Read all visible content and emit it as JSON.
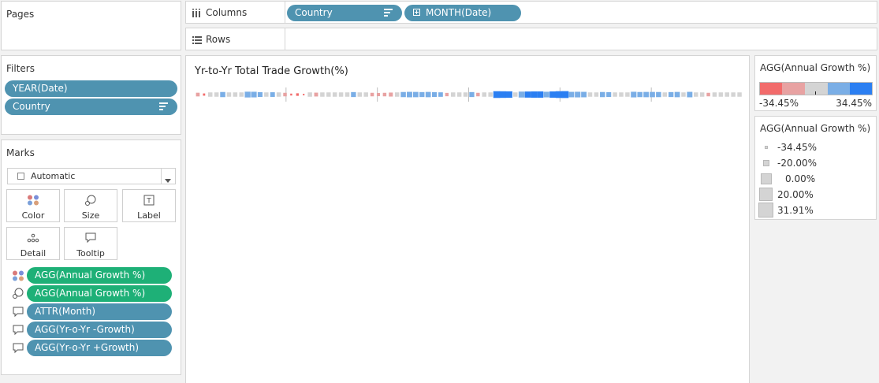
{
  "pages": {
    "title": "Pages"
  },
  "columns_shelf": {
    "label": "Columns",
    "icon": "columns-icon",
    "pills": [
      {
        "label": "Country"
      },
      {
        "label": "MONTH(Date)"
      }
    ]
  },
  "rows_shelf": {
    "label": "Rows",
    "icon": "rows-icon"
  },
  "filters": {
    "title": "Filters",
    "pills": [
      {
        "label": "YEAR(Date)"
      },
      {
        "label": "Country"
      }
    ]
  },
  "marks": {
    "title": "Marks",
    "mark_type": "Automatic",
    "buttons": [
      {
        "label": "Color",
        "icon": "color-icon"
      },
      {
        "label": "Size",
        "icon": "size-icon"
      },
      {
        "label": "Label",
        "icon": "label-icon"
      },
      {
        "label": "Detail",
        "icon": "detail-icon"
      },
      {
        "label": "Tooltip",
        "icon": "tooltip-icon"
      }
    ],
    "fields": [
      {
        "label": "AGG(Annual Growth %)",
        "icon": "color-icon",
        "color": "#1eb077"
      },
      {
        "label": "AGG(Annual Growth %)",
        "icon": "size-icon",
        "color": "#1eb077"
      },
      {
        "label": "ATTR(Month)",
        "icon": "tooltip-icon",
        "color": "#4f93b0"
      },
      {
        "label": "AGG(Yr-o-Yr -Growth)",
        "icon": "tooltip-icon",
        "color": "#4f93b0"
      },
      {
        "label": "AGG(Yr-o-Yr +Growth)",
        "icon": "tooltip-icon",
        "color": "#4f93b0"
      }
    ]
  },
  "view": {
    "title": "Yr-to-Yr Total Trade Growth(%)"
  },
  "color_legend": {
    "title": "AGG(Annual Growth %)",
    "min_label": "-34.45%",
    "max_label": "34.45%",
    "colors": [
      "#f26b6b",
      "#e8a2a2",
      "#d4d4d4",
      "#7aaee6",
      "#2b7ff2"
    ]
  },
  "size_legend": {
    "title": "AGG(Annual Growth %)",
    "items": [
      {
        "label": "-34.45%",
        "value": -34.45
      },
      {
        "label": "-20.00%",
        "value": -20.0
      },
      {
        "label": "0.00%",
        "value": 0.0
      },
      {
        "label": "20.00%",
        "value": 20.0
      },
      {
        "label": "31.91%",
        "value": 31.91
      }
    ]
  },
  "chart_data": {
    "type": "heatmap",
    "title": "Yr-to-Yr Total Trade Growth(%)",
    "measure": "AGG(Annual Growth %)",
    "color_range": [
      -34.45,
      34.45
    ],
    "groups": 6,
    "values": [
      -8,
      -26,
      0,
      0,
      10,
      0,
      0,
      0,
      18,
      16,
      6,
      0,
      4,
      0,
      -10,
      -30,
      -22,
      -34,
      0,
      -6,
      0,
      0,
      0,
      0,
      0,
      8,
      0,
      0,
      -10,
      -14,
      -10,
      -4,
      0,
      10,
      14,
      12,
      8,
      12,
      6,
      2,
      -12,
      0,
      0,
      0,
      8,
      -10,
      0,
      0,
      30,
      28,
      26,
      0,
      20,
      22,
      24,
      24,
      16,
      24,
      30,
      31.91,
      14,
      16,
      14,
      0,
      0,
      10,
      6,
      0,
      0,
      0,
      16,
      10,
      12,
      12,
      10,
      0,
      8,
      12,
      0,
      14,
      0,
      0,
      -10,
      0,
      0,
      0,
      0,
      0
    ]
  }
}
